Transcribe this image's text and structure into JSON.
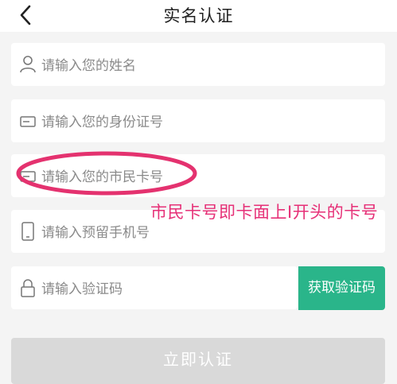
{
  "header": {
    "title": "实名认证",
    "back_icon": "chevron-left-icon"
  },
  "form": {
    "name_placeholder": "请输入您的姓名",
    "id_placeholder": "请输入您的身份证号",
    "citizen_card_placeholder": "请输入您的市民卡号",
    "phone_placeholder": "请输入预留手机号",
    "code_placeholder": "请输入验证码",
    "get_code_label": "获取验证码",
    "submit_label": "立即认证"
  },
  "annotation": {
    "text": "市民卡号即卡面上I开头的卡号"
  },
  "colors": {
    "accent": "#2ab58a",
    "annotation": "#e63077",
    "disabled_button": "#d9d9d9",
    "background": "#f4f4f4"
  }
}
